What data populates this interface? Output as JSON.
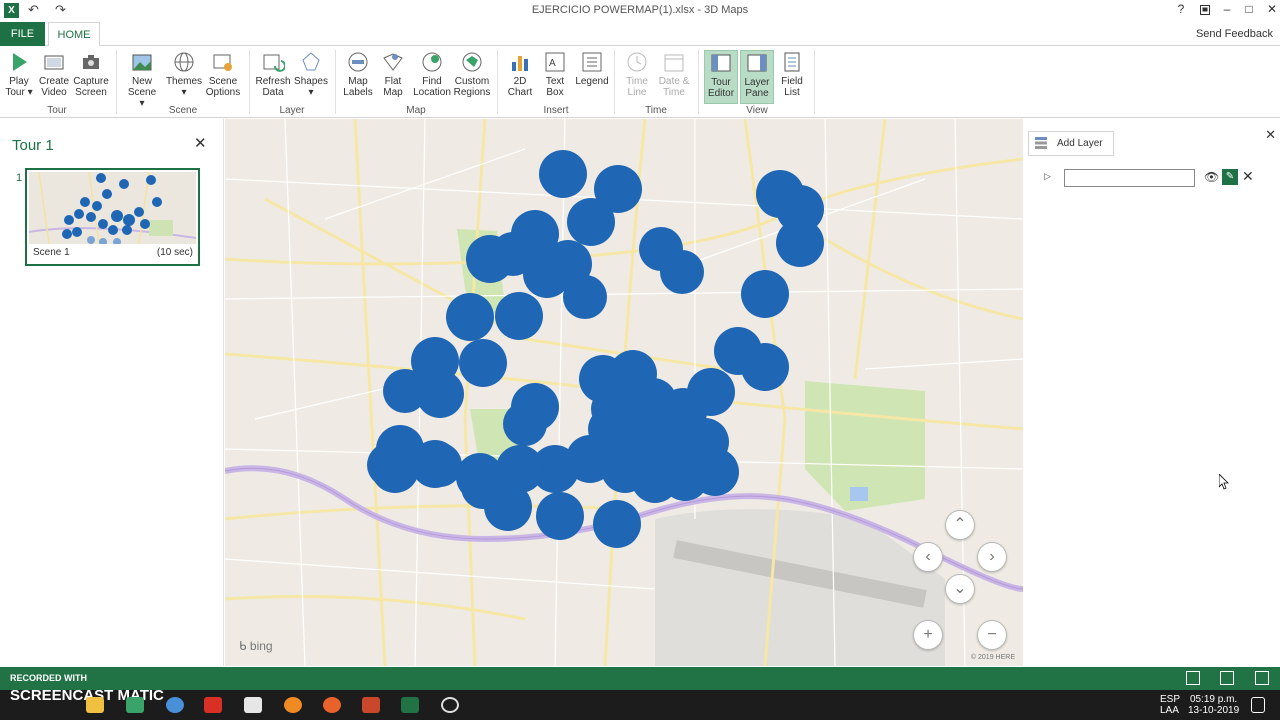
{
  "window": {
    "title": "EJERCICIO POWERMAP(1).xlsx - 3D Maps",
    "help_label": "?",
    "controls": {
      "restore_icon": "restore-icon",
      "minimize": "–",
      "maximize": "□",
      "close": "✕"
    }
  },
  "tabs": {
    "file": "FILE",
    "home": "HOME",
    "send_feedback": "Send Feedback"
  },
  "ribbon": {
    "groups": {
      "tour": "Tour",
      "scene": "Scene",
      "layer": "Layer",
      "map": "Map",
      "insert": "Insert",
      "time": "Time",
      "view": "View"
    },
    "buttons": {
      "play_tour": [
        "Play",
        "Tour ▾"
      ],
      "create_video": [
        "Create",
        "Video"
      ],
      "capture_screen": [
        "Capture",
        "Screen"
      ],
      "new_scene": [
        "New",
        "Scene ▾"
      ],
      "themes": [
        "Themes",
        "▾"
      ],
      "scene_options": [
        "Scene",
        "Options"
      ],
      "refresh_data": [
        "Refresh",
        "Data"
      ],
      "shapes": [
        "Shapes",
        "▾"
      ],
      "map_labels": [
        "Map",
        "Labels"
      ],
      "flat_map": [
        "Flat",
        "Map"
      ],
      "find_location": [
        "Find",
        "Location"
      ],
      "custom_regions": [
        "Custom",
        "Regions"
      ],
      "chart_2d": [
        "2D",
        "Chart"
      ],
      "text_box": [
        "Text",
        "Box"
      ],
      "legend": [
        "Legend",
        ""
      ],
      "time_line": [
        "Time",
        "Line"
      ],
      "date_time": [
        "Date &",
        "Time"
      ],
      "tour_editor": [
        "Tour",
        "Editor"
      ],
      "layer_pane": [
        "Layer",
        "Pane"
      ],
      "field_list": [
        "Field",
        "List"
      ]
    }
  },
  "tour_panel": {
    "title": "Tour 1",
    "scene_number": "1",
    "scene_name": "Scene 1",
    "scene_duration": "(10 sec)"
  },
  "map": {
    "provider": "bing",
    "copyright": "© 2019 HERE",
    "bubble_color": "#1f66b5"
  },
  "layer_pane": {
    "add_layer": "Add Layer",
    "layer_name_value": ""
  },
  "statusbar": {
    "recorded_with": "RECORDED WITH"
  },
  "taskbar": {
    "brand": "SCREENCAST   MATIC",
    "lang_top": "ESP",
    "lang_bottom": "LAA",
    "time": "05:19 p.m.",
    "date": "13-10-2019"
  },
  "colors": {
    "accent": "#217346",
    "selected_view": "#b9dcc6"
  }
}
